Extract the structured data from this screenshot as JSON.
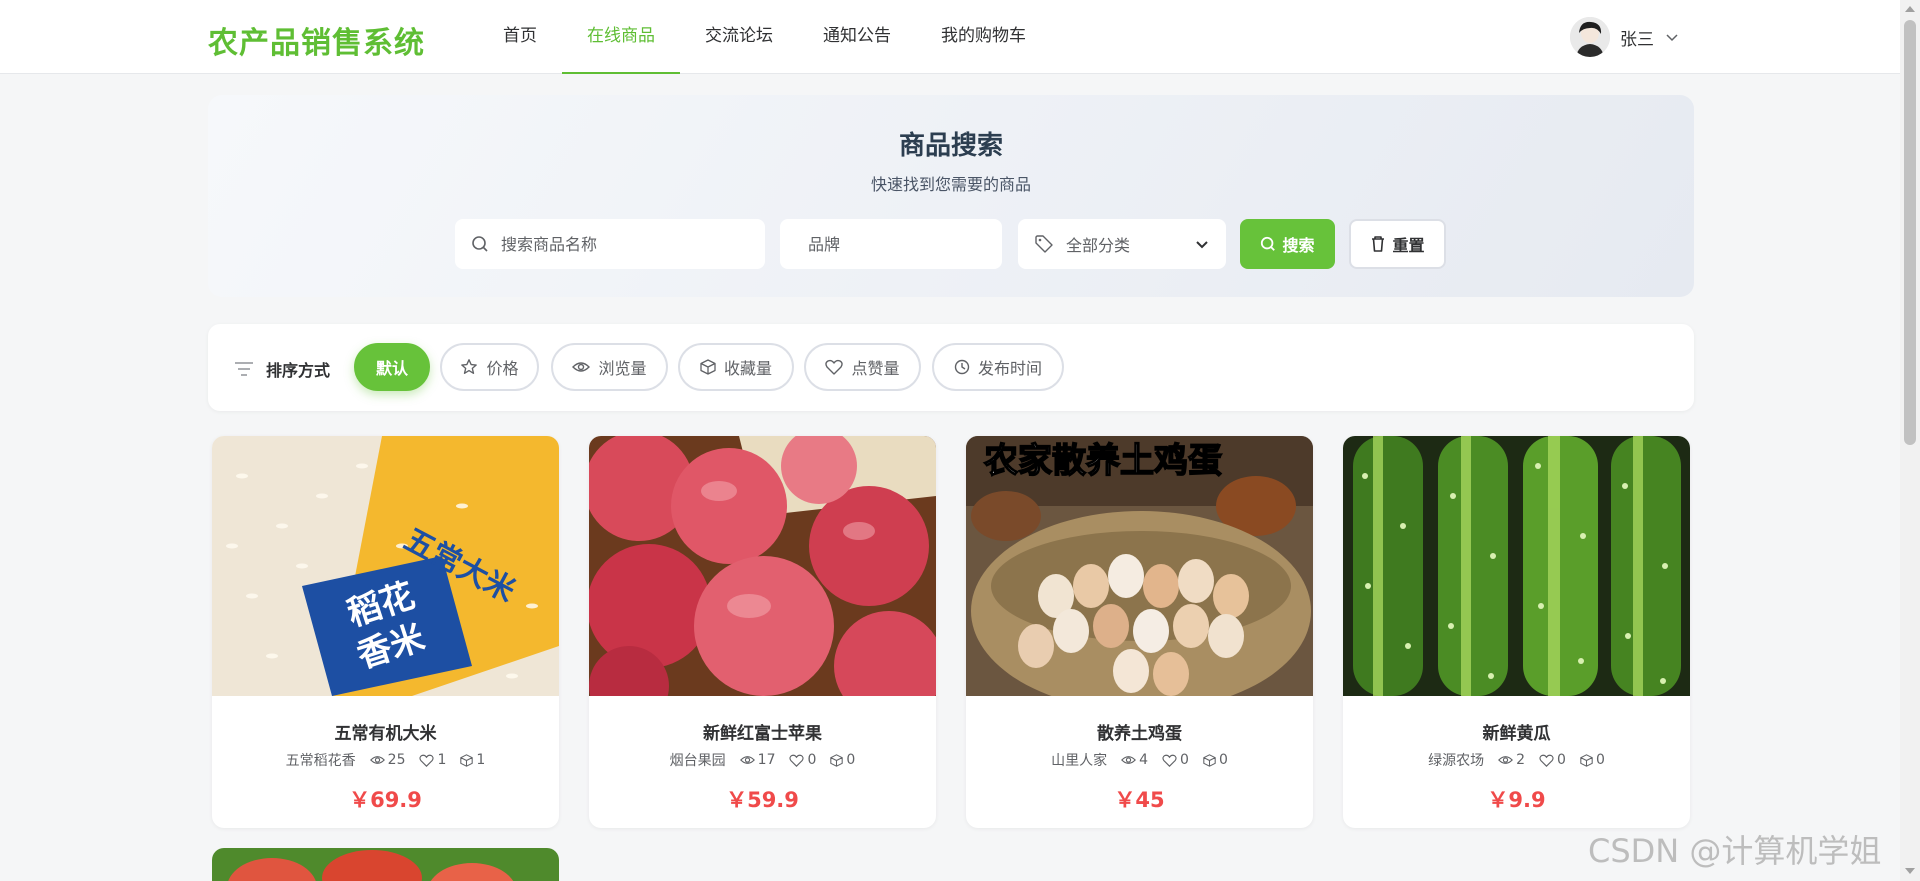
{
  "header": {
    "logo": "农产品销售系统",
    "nav": [
      {
        "label": "首页",
        "active": false
      },
      {
        "label": "在线商品",
        "active": true
      },
      {
        "label": "交流论坛",
        "active": false
      },
      {
        "label": "通知公告",
        "active": false
      },
      {
        "label": "我的购物车",
        "active": false
      }
    ],
    "user_name": "张三"
  },
  "search": {
    "title": "商品搜索",
    "subtitle": "快速找到您需要的商品",
    "name_placeholder": "搜索商品名称",
    "brand_placeholder": "品牌",
    "category_value": "全部分类",
    "search_label": "搜索",
    "reset_label": "重置"
  },
  "sort": {
    "label": "排序方式",
    "options": [
      {
        "label": "默认",
        "icon": "none",
        "active": true
      },
      {
        "label": "价格",
        "icon": "star-icon",
        "active": false
      },
      {
        "label": "浏览量",
        "icon": "eye-icon",
        "active": false
      },
      {
        "label": "收藏量",
        "icon": "box-icon",
        "active": false
      },
      {
        "label": "点赞量",
        "icon": "heart-icon",
        "active": false
      },
      {
        "label": "发布时间",
        "icon": "clock-icon",
        "active": false
      }
    ]
  },
  "products": [
    {
      "name": "五常有机大米",
      "brand": "五常稻花香",
      "views": "25",
      "likes": "1",
      "favorites": "1",
      "price": "￥69.9",
      "image_labels": [
        "五常大米",
        "稻花",
        "香米"
      ]
    },
    {
      "name": "新鲜红富士苹果",
      "brand": "烟台果园",
      "views": "17",
      "likes": "0",
      "favorites": "0",
      "price": "￥59.9"
    },
    {
      "name": "散养土鸡蛋",
      "brand": "山里人家",
      "views": "4",
      "likes": "0",
      "favorites": "0",
      "price": "￥45",
      "image_labels": [
        "农家散养土鸡蛋"
      ]
    },
    {
      "name": "新鲜黄瓜",
      "brand": "绿源农场",
      "views": "2",
      "likes": "0",
      "favorites": "0",
      "price": "￥9.9"
    }
  ],
  "watermark": "CSDN @计算机学姐",
  "colors": {
    "brand": "#5fbe34",
    "accent": "#67c23a",
    "price": "#f04a4a"
  }
}
